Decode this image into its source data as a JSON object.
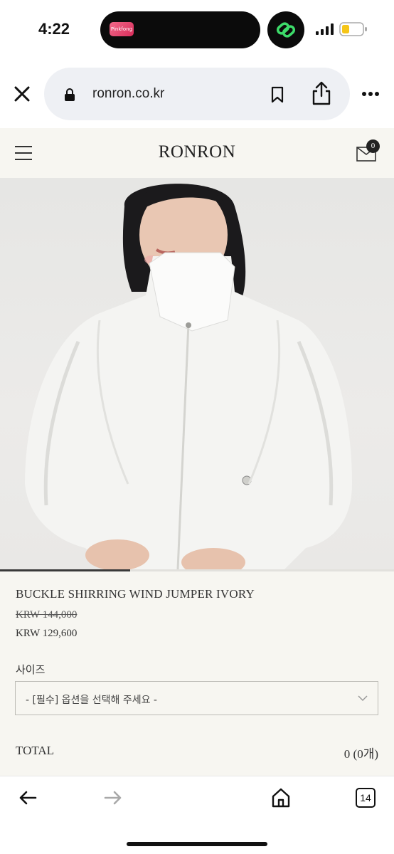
{
  "status_bar": {
    "time": "4:22",
    "island_badge": "Pinkfong",
    "accent_green": "#3ddc6a",
    "battery_color": "#f5c518"
  },
  "browser": {
    "url": "ronron.co.kr",
    "tab_count": "14"
  },
  "site": {
    "logo": "RONRON",
    "cart_count": "0"
  },
  "product": {
    "name": "BUCKLE SHIRRING WIND JUMPER IVORY",
    "price_original": "KRW 144,000",
    "price_sale": "KRW 129,600",
    "option_label": "사이즈",
    "option_placeholder": "- [필수] 옵션을 선택해 주세요 -",
    "total_label": "TOTAL",
    "total_value": "0 (0개)",
    "gallery_progress": 0.33
  },
  "icons": {
    "close": "close-icon",
    "lock": "lock-icon",
    "bookmark": "bookmark-icon",
    "share": "share-icon",
    "more": "more-icon",
    "menu": "hamburger-icon",
    "cart": "cart-icon",
    "back": "back-arrow-icon",
    "forward": "forward-arrow-icon",
    "home": "home-icon",
    "tabs": "tabs-icon"
  }
}
